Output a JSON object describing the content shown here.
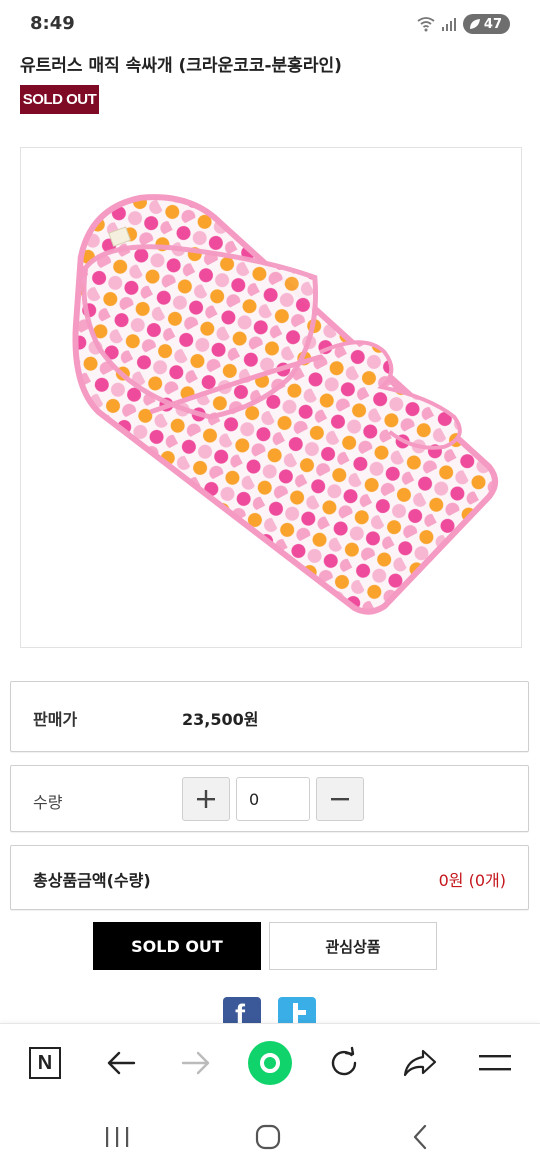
{
  "status_bar": {
    "time": "8:49",
    "battery": "47"
  },
  "product": {
    "title": "유트러스 매직 속싸개 (크라운코코-분홍라인)",
    "soldout_badge": "SOLD OUT"
  },
  "price": {
    "label": "판매가",
    "value": "23,500원"
  },
  "quantity": {
    "label": "수량",
    "value": "0"
  },
  "total": {
    "label": "총상품금액(수량)",
    "value": "0원 (0개)"
  },
  "actions": {
    "soldout_button": "SOLD OUT",
    "wishlist_button": "관심상품"
  },
  "social": {
    "facebook_letter": "f"
  },
  "toolbar": {
    "naver_letter": "N"
  },
  "colors": {
    "accent_red": "#c4161c",
    "badge_maroon": "#7e0a25",
    "facebook_blue": "#3b5998",
    "twitter_blue": "#3aaee6",
    "home_green": "#11d36b"
  }
}
